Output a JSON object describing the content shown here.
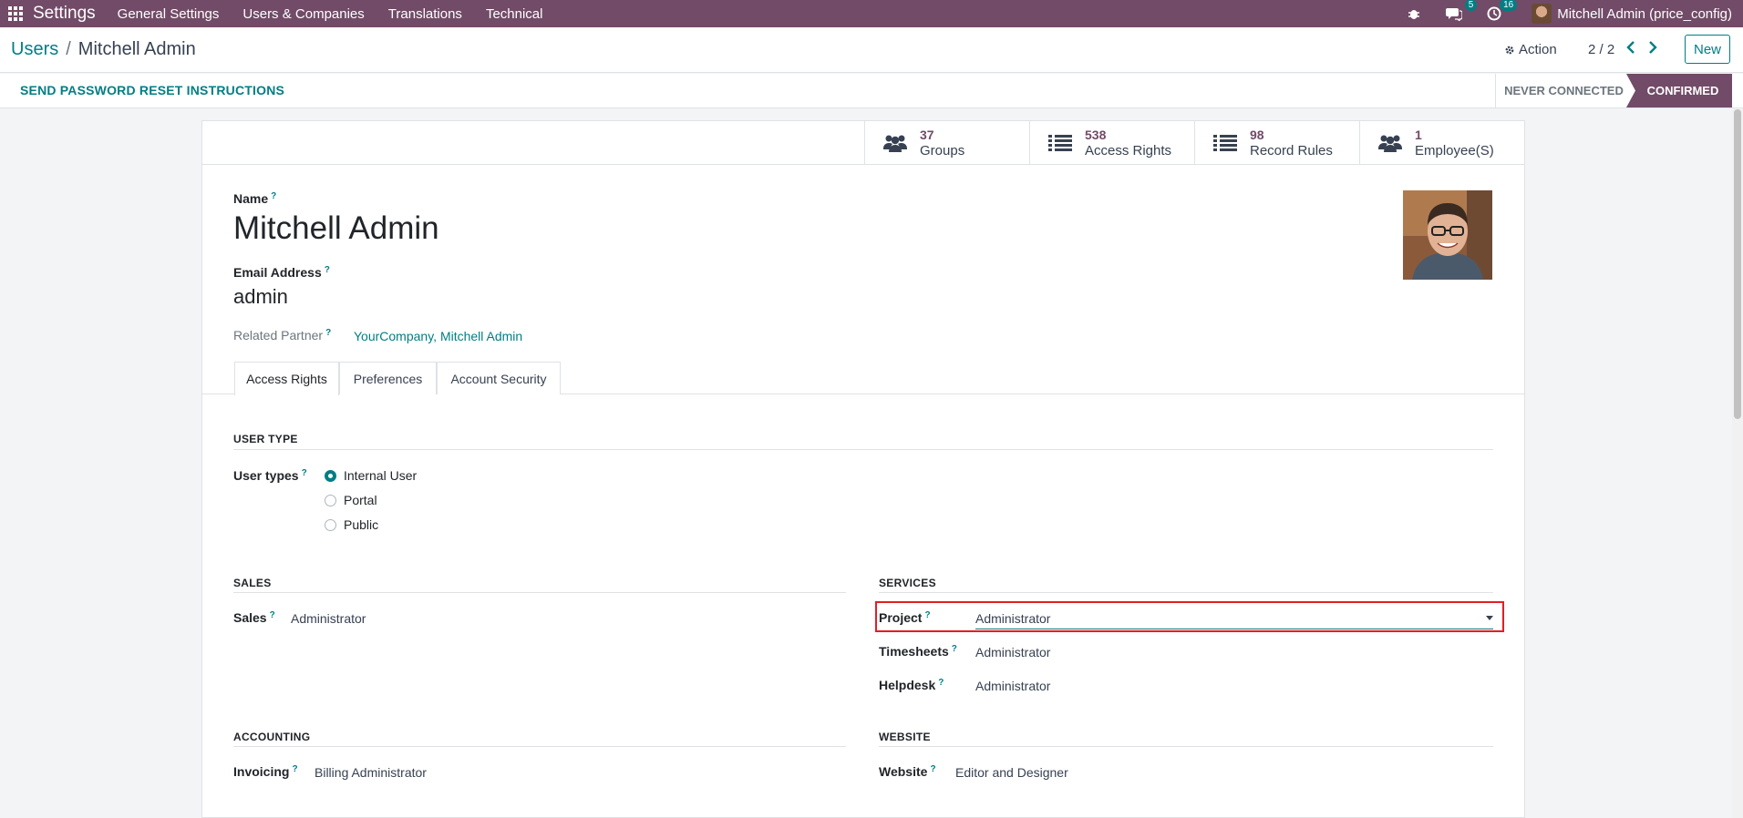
{
  "navbar": {
    "app_name": "Settings",
    "menu": [
      "General Settings",
      "Users & Companies",
      "Translations",
      "Technical"
    ],
    "messages_count": "5",
    "activities_count": "16",
    "user": "Mitchell Admin (price_config)"
  },
  "control_panel": {
    "breadcrumb_parent": "Users",
    "breadcrumb_separator": "/",
    "breadcrumb_current": "Mitchell Admin",
    "action_label": "Action",
    "pager": "2 / 2",
    "new_label": "New"
  },
  "statusbar": {
    "reset_label": "SEND PASSWORD RESET INSTRUCTIONS",
    "states": [
      "NEVER CONNECTED",
      "CONFIRMED"
    ],
    "active_state": "CONFIRMED"
  },
  "stat_buttons": [
    {
      "value": "37",
      "label": "Groups",
      "icon": "users-icon"
    },
    {
      "value": "538",
      "label": "Access Rights",
      "icon": "list-icon"
    },
    {
      "value": "98",
      "label": "Record Rules",
      "icon": "list-icon"
    },
    {
      "value": "1",
      "label": "Employee(S)",
      "icon": "users-icon"
    }
  ],
  "form": {
    "name_label": "Name",
    "name": "Mitchell Admin",
    "email_label": "Email Address",
    "email": "admin",
    "partner_label": "Related Partner",
    "partner": "YourCompany, Mitchell Admin",
    "help_mark": "?"
  },
  "tabs": [
    "Access Rights",
    "Preferences",
    "Account Security"
  ],
  "active_tab": "Access Rights",
  "access_rights": {
    "user_type_title": "USER TYPE",
    "user_types_label": "User types",
    "user_types": [
      "Internal User",
      "Portal",
      "Public"
    ],
    "selected_user_type": "Internal User",
    "sales": {
      "title": "SALES",
      "label": "Sales",
      "value": "Administrator"
    },
    "services": {
      "title": "SERVICES",
      "project_label": "Project",
      "project_value": "Administrator",
      "timesheets_label": "Timesheets",
      "timesheets_value": "Administrator",
      "helpdesk_label": "Helpdesk",
      "helpdesk_value": "Administrator"
    },
    "accounting": {
      "title": "ACCOUNTING",
      "label": "Invoicing",
      "value": "Billing Administrator"
    },
    "website": {
      "title": "WEBSITE",
      "label": "Website",
      "value": "Editor and Designer"
    }
  },
  "colors": {
    "brand": "#714b67",
    "accent": "#017e84",
    "highlight": "#e31e24"
  }
}
